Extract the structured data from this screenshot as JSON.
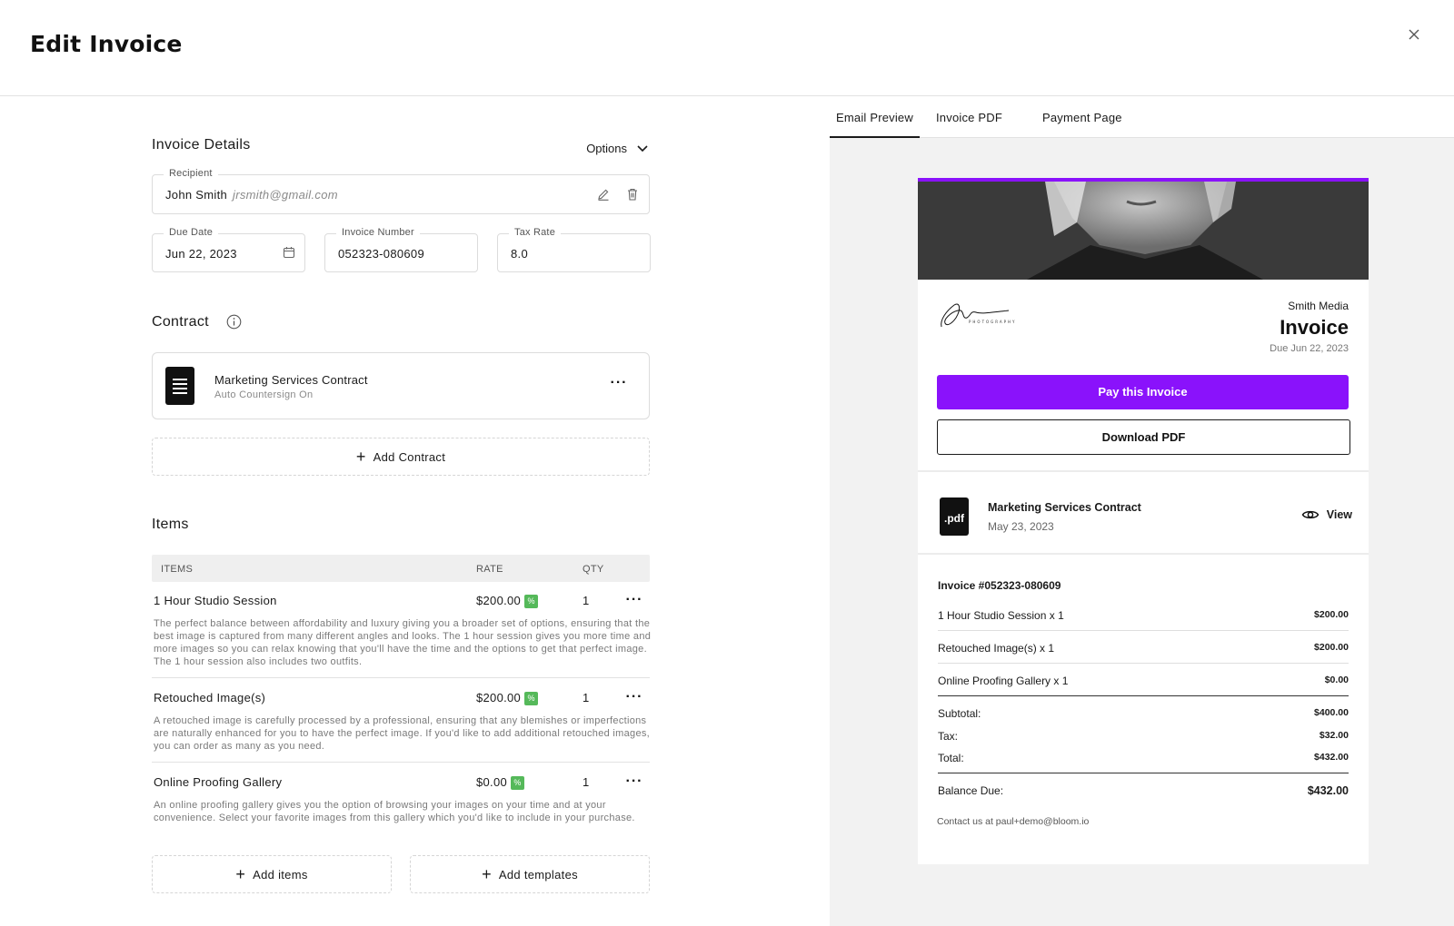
{
  "header": {
    "title": "Edit Invoice",
    "close_icon": "close-icon"
  },
  "invoice_details": {
    "title": "Invoice Details",
    "options_label": "Options",
    "recipient": {
      "label": "Recipient",
      "name": "John Smith",
      "email": "jrsmith@gmail.com"
    },
    "due_date": {
      "label": "Due Date",
      "value": "Jun 22, 2023"
    },
    "invoice_number": {
      "label": "Invoice Number",
      "value": "052323-080609"
    },
    "tax_rate": {
      "label": "Tax Rate",
      "value": "8.0"
    }
  },
  "contract": {
    "title": "Contract",
    "name": "Marketing Services Contract",
    "sub": "Auto Countersign On",
    "add_label": "Add Contract"
  },
  "items": {
    "title": "Items",
    "columns": {
      "items": "ITEMS",
      "rate": "RATE",
      "qty": "QTY"
    },
    "rows": [
      {
        "name": "1 Hour Studio Session",
        "rate": "$200.00",
        "qty": "1",
        "desc": "The perfect balance between affordability and luxury giving you a broader set of options, ensuring that the best image is captured from many different angles and looks. The 1 hour session gives you more time and more images so you can relax knowing that you'll have the time and the options to get that perfect image. The 1 hour session also includes two outfits."
      },
      {
        "name": "Retouched Image(s)",
        "rate": "$200.00",
        "qty": "1",
        "desc": "A retouched image is carefully processed by a professional, ensuring that any blemishes or imperfections are naturally enhanced for you to have the perfect image. If you'd like to add additional retouched images, you can order as many as you need."
      },
      {
        "name": "Online Proofing Gallery",
        "rate": "$0.00",
        "qty": "1",
        "desc": "An online proofing gallery gives you the option of browsing your images on your time and at your convenience. Select your favorite images from this gallery which you'd like to include in your purchase."
      }
    ],
    "discount_badge": "%",
    "add_items_label": "Add items",
    "add_templates_label": "Add templates"
  },
  "preview": {
    "tabs": [
      "Email Preview",
      "Invoice PDF",
      "Payment Page"
    ],
    "active_tab": "Email Preview",
    "company": "Smith Media",
    "invoice_title": "Invoice",
    "due": "Due Jun 22, 2023",
    "pay_label": "Pay this Invoice",
    "download_label": "Download PDF",
    "pdf_badge": ".pdf",
    "contract_name": "Marketing Services Contract",
    "contract_date": "May 23, 2023",
    "view_label": "View",
    "invoice_number": "Invoice #052323-080609",
    "lines": [
      {
        "label": "1 Hour Studio Session x 1",
        "amount": "$200.00"
      },
      {
        "label": "Retouched Image(s) x 1",
        "amount": "$200.00"
      },
      {
        "label": "Online Proofing Gallery x 1",
        "amount": "$0.00"
      }
    ],
    "subtotal": {
      "label": "Subtotal:",
      "amount": "$400.00"
    },
    "tax": {
      "label": "Tax:",
      "amount": "$32.00"
    },
    "total": {
      "label": "Total:",
      "amount": "$432.00"
    },
    "balance": {
      "label": "Balance Due:",
      "amount": "$432.00"
    },
    "contact": "Contact us at paul+demo@bloom.io"
  },
  "colors": {
    "accent": "#8a12fb",
    "discount": "#55b95a",
    "panel": "#f2f2f2"
  }
}
